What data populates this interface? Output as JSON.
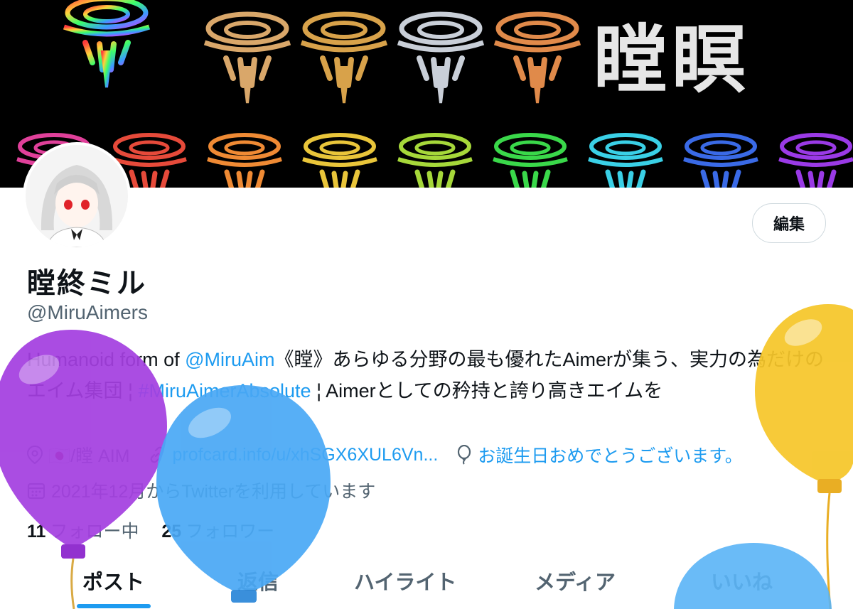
{
  "profile": {
    "display_name": "瞠終ミル",
    "handle": "@MiruAimers",
    "edit_label": "編集",
    "bio": {
      "part1": "Humanoid form of ",
      "mention": "@MiruAim",
      "part2": "《瞠》あらゆる分野の最も優れたAimerが集う、実力の為だけのエイム集団 ¦ ",
      "hashtag": "#MiruAimerAbsolute",
      "part3": " ¦ Aimerとしての矜持と誇り高きエイムを"
    },
    "location": "🇯🇵/瞠 AIM",
    "url": "profcard.info/u/xhSGX6XUL6Vn...",
    "birthday": "お誕生日おめでとうございます。",
    "joined": "2021年12月からTwitterを利用しています",
    "following_count": "11",
    "following_label": "フォロー中",
    "followers_count": "25",
    "followers_label": "フォロワー"
  },
  "banner": {
    "title": "瞠瞑"
  },
  "tabs": [
    {
      "label": "ポスト"
    },
    {
      "label": "返信"
    },
    {
      "label": "ハイライト"
    },
    {
      "label": "メディア"
    },
    {
      "label": "いいね"
    }
  ],
  "colors": {
    "accent": "#1d9bf0",
    "text": "#0f1419",
    "secondary": "#536471",
    "balloon_purple": "#a43fe0",
    "balloon_blue": "#49a8f5",
    "balloon_yellow": "#f6c62a"
  }
}
